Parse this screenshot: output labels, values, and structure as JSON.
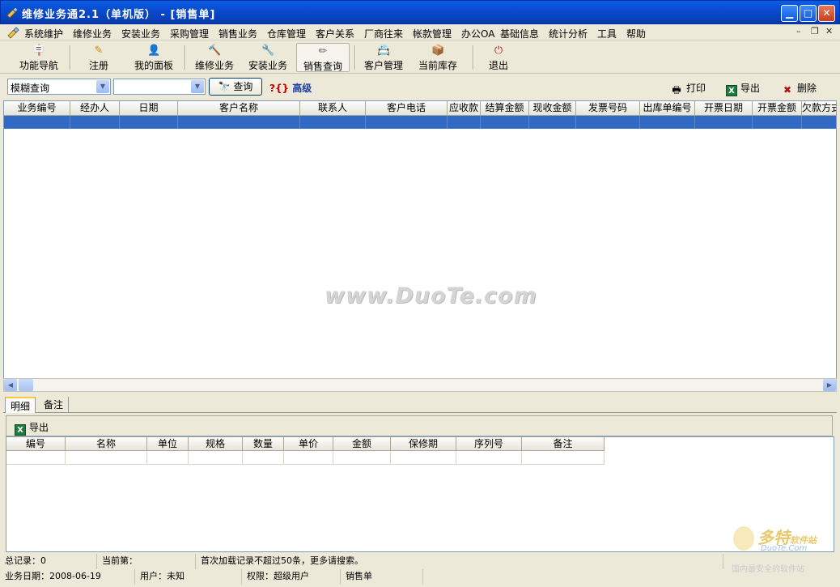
{
  "window": {
    "title": "维修业务通2.1（单机版） - [销售单]",
    "controls": [
      "minimize",
      "maximize",
      "close"
    ]
  },
  "menu": {
    "items": [
      "系统维护",
      "维修业务",
      "安装业务",
      "采购管理",
      "销售业务",
      "仓库管理",
      "客户关系",
      "厂商往来",
      "帐款管理",
      "办公OA",
      "基础信息",
      "统计分析",
      "工具",
      "帮助"
    ]
  },
  "toolbar": {
    "buttons": [
      {
        "label": "功能导航",
        "icon": "signpost-icon"
      },
      {
        "label": "注册",
        "icon": "pen-icon"
      },
      {
        "label": "我的面板",
        "icon": "person-icon"
      },
      {
        "label": "维修业务",
        "icon": "hammer-icon"
      },
      {
        "label": "安装业务",
        "icon": "install-icon"
      },
      {
        "label": "销售查询",
        "icon": "pencil-list-icon"
      },
      {
        "label": "客户管理",
        "icon": "customer-icon"
      },
      {
        "label": "当前库存",
        "icon": "stock-icon"
      },
      {
        "label": "退出",
        "icon": "exit-icon"
      }
    ]
  },
  "search": {
    "mode_value": "模糊查询",
    "keyword_value": "",
    "query_label": "查询",
    "advanced_label": "高级",
    "print_label": "打印",
    "export_label": "导出",
    "delete_label": "删除"
  },
  "grid": {
    "columns": [
      "业务编号",
      "经办人",
      "日期",
      "客户名称",
      "联系人",
      "客户电话",
      "应收款",
      "结算金额",
      "现收金额",
      "发票号码",
      "出库单编号",
      "开票日期",
      "开票金额",
      "欠款方式"
    ],
    "rows": []
  },
  "watermark_text": "www.DuoTe.com",
  "tabs": [
    "明细",
    "备注"
  ],
  "detail": {
    "export_label": "导出",
    "columns": [
      "编号",
      "名称",
      "单位",
      "规格",
      "数量",
      "单价",
      "金额",
      "保修期",
      "序列号",
      "备注"
    ]
  },
  "status": {
    "total_records": "总记录：0",
    "current": "当前第：",
    "message": "首次加载记录不超过50条，更多请搜索。",
    "business_date": "业务日期：2008-06-19",
    "user": "用户：未知",
    "permission": "权限：超级用户",
    "form": "销售单"
  },
  "logo": {
    "cn": "多特",
    "cn_suffix": "软件站",
    "en": "DuoTe.Com",
    "slogan": "国内最安全的软件站"
  },
  "colors": {
    "titlebar": "#0a4fd6",
    "selection": "#316ac5",
    "chrome": "#ece9d8"
  }
}
